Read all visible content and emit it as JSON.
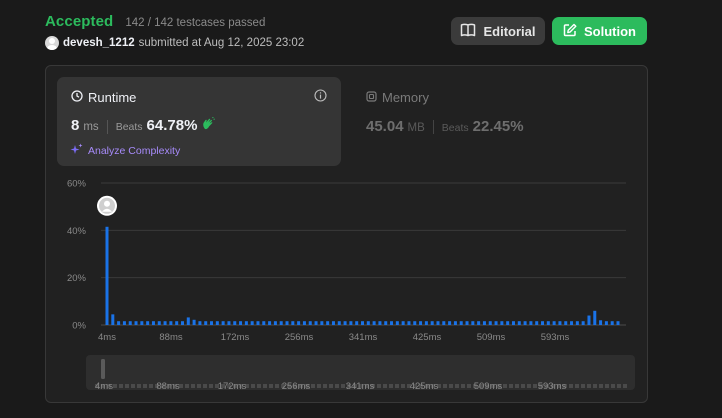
{
  "status": {
    "label": "Accepted",
    "testcases": "142 / 142 testcases passed"
  },
  "submission": {
    "username": "devesh_1212",
    "submitted_text": "submitted at Aug 12, 2025 23:02"
  },
  "buttons": {
    "editorial": "Editorial",
    "solution": "Solution"
  },
  "runtime": {
    "title": "Runtime",
    "value": "8",
    "unit": "ms",
    "beats_label": "Beats",
    "beats": "64.78%",
    "analyze": "Analyze Complexity"
  },
  "memory": {
    "title": "Memory",
    "value": "45.04",
    "unit": "MB",
    "beats_label": "Beats",
    "beats": "22.45%"
  },
  "colors": {
    "accent": "#2cbb5d",
    "bar": "#1a73e8",
    "analyze": "#a78bfa"
  },
  "chart_data": {
    "type": "bar",
    "xlabel": "",
    "ylabel": "",
    "ylim": [
      0,
      60
    ],
    "y_ticks": [
      "0%",
      "20%",
      "40%",
      "60%"
    ],
    "x_ticks": [
      "4ms",
      "88ms",
      "172ms",
      "256ms",
      "341ms",
      "425ms",
      "509ms",
      "593ms"
    ],
    "grid": true,
    "user_marker_bar_index": 0,
    "values": [
      41.5,
      4.5,
      1.6,
      1.6,
      1.6,
      1.6,
      1.6,
      1.6,
      1.6,
      1.6,
      1.6,
      1.6,
      1.6,
      1.6,
      3.2,
      2.2,
      1.6,
      1.6,
      1.6,
      1.6,
      1.6,
      1.6,
      1.6,
      1.6,
      1.6,
      1.6,
      1.6,
      1.6,
      1.6,
      1.6,
      1.6,
      1.6,
      1.6,
      1.6,
      1.6,
      1.6,
      1.6,
      1.6,
      1.6,
      1.6,
      1.6,
      1.6,
      1.6,
      1.6,
      1.6,
      1.6,
      1.6,
      1.6,
      1.6,
      1.6,
      1.6,
      1.6,
      1.6,
      1.6,
      1.6,
      1.6,
      1.6,
      1.6,
      1.6,
      1.6,
      1.6,
      1.6,
      1.6,
      1.6,
      1.6,
      1.6,
      1.6,
      1.6,
      1.6,
      1.6,
      1.6,
      1.6,
      1.6,
      1.6,
      1.6,
      1.6,
      1.6,
      1.6,
      1.6,
      1.6,
      1.6,
      1.6,
      1.6,
      4.0,
      6.0,
      2.0,
      1.6,
      1.6,
      1.6
    ]
  }
}
